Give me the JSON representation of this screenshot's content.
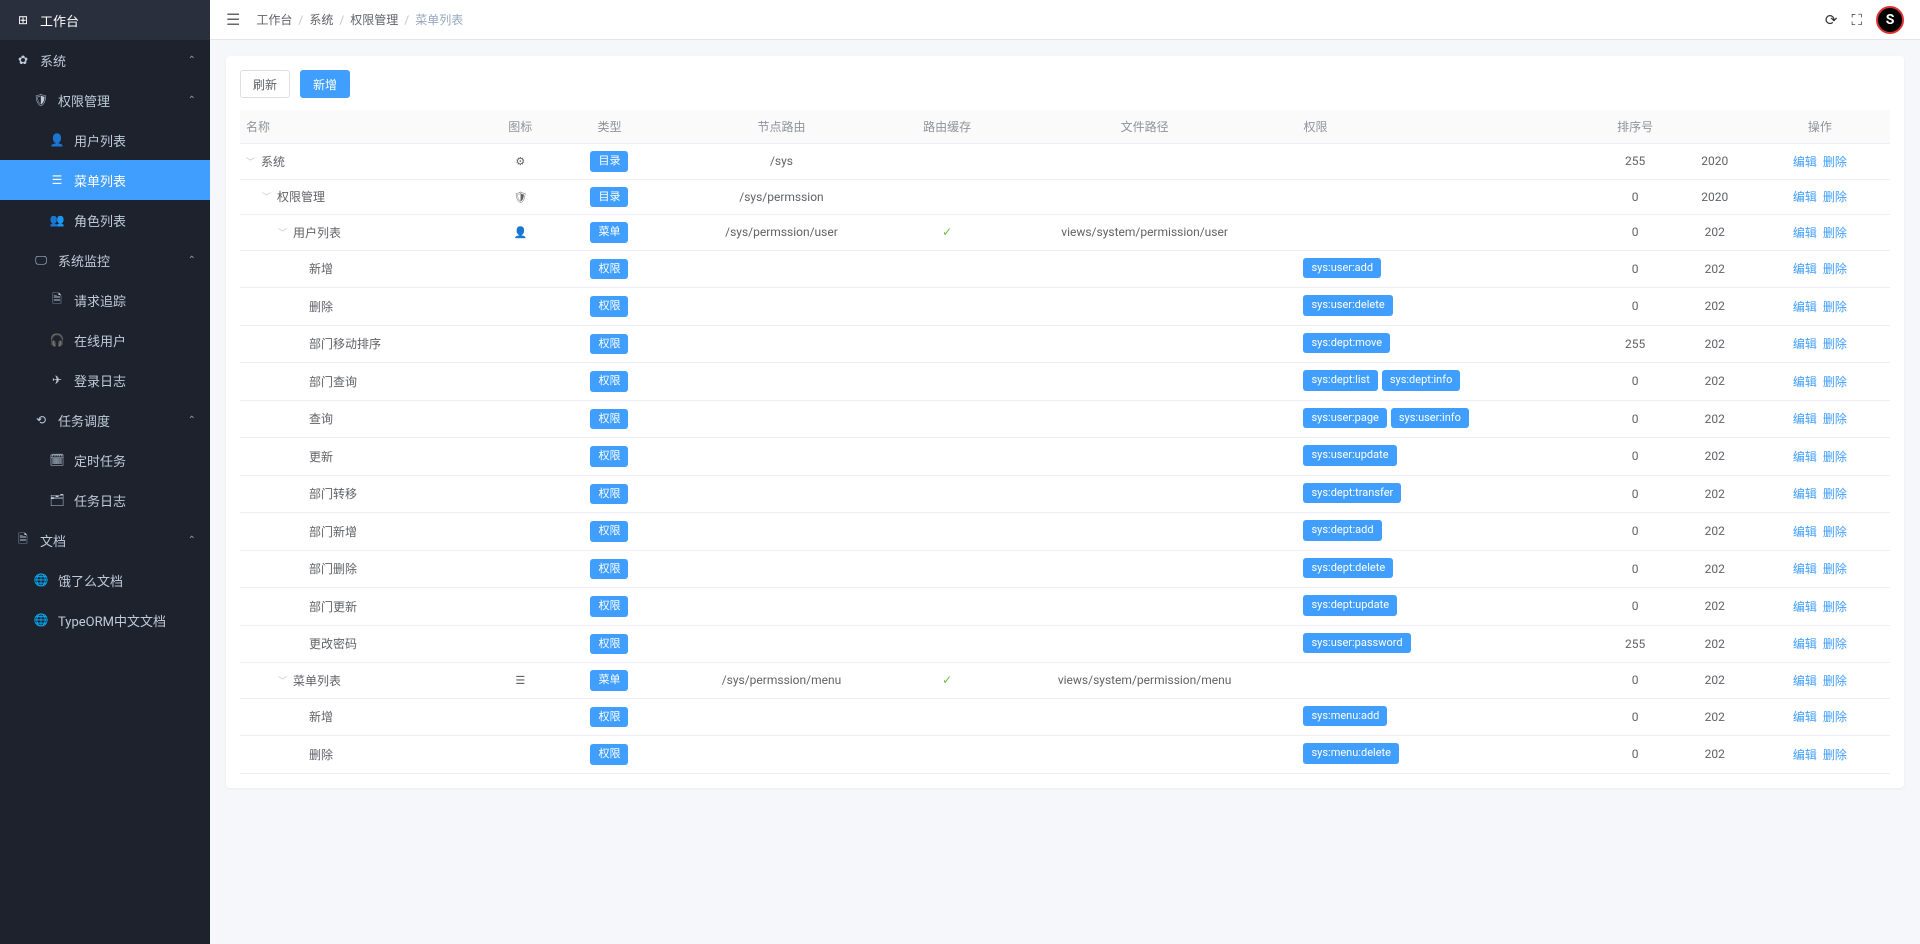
{
  "sidebar": {
    "items": [
      {
        "label": "工作台",
        "icon": "⊞",
        "level": 0
      },
      {
        "label": "系统",
        "icon": "✿",
        "level": 0,
        "arrow": "up"
      },
      {
        "label": "权限管理",
        "icon": "🛡",
        "level": 1,
        "arrow": "up"
      },
      {
        "label": "用户列表",
        "icon": "👤",
        "level": 2
      },
      {
        "label": "菜单列表",
        "icon": "☰",
        "level": 2,
        "active": true
      },
      {
        "label": "角色列表",
        "icon": "👥",
        "level": 2
      },
      {
        "label": "系统监控",
        "icon": "🖵",
        "level": 1,
        "arrow": "up"
      },
      {
        "label": "请求追踪",
        "icon": "🗎",
        "level": 2
      },
      {
        "label": "在线用户",
        "icon": "🎧",
        "level": 2
      },
      {
        "label": "登录日志",
        "icon": "✈",
        "level": 2
      },
      {
        "label": "任务调度",
        "icon": "⟲",
        "level": 1,
        "arrow": "up"
      },
      {
        "label": "定时任务",
        "icon": "🗓",
        "level": 2
      },
      {
        "label": "任务日志",
        "icon": "🗂",
        "level": 2
      },
      {
        "label": "文档",
        "icon": "🗎",
        "level": 0,
        "arrow": "up"
      },
      {
        "label": "饿了么文档",
        "icon": "🌐",
        "level": 1
      },
      {
        "label": "TypeORM中文文档",
        "icon": "🌐",
        "level": 1
      }
    ]
  },
  "breadcrumb": {
    "items": [
      "工作台",
      "系统",
      "权限管理",
      "菜单列表"
    ]
  },
  "toolbar": {
    "refresh": "刷新",
    "add": "新增"
  },
  "table": {
    "headers": {
      "name": "名称",
      "icon": "图标",
      "type": "类型",
      "route": "节点路由",
      "cache": "路由缓存",
      "file": "文件路径",
      "perm": "权限",
      "sort": "排序号",
      "time": "",
      "op": "操作"
    },
    "actions": {
      "edit": "编辑",
      "delete": "删除"
    },
    "typeLabels": {
      "dir": "目录",
      "menu": "菜单",
      "perm": "权限"
    },
    "rows": [
      {
        "indent": 0,
        "caret": true,
        "name": "系统",
        "icon": "⚙",
        "type": "dir",
        "route": "/sys",
        "cache": "",
        "file": "",
        "perms": [],
        "sort": "255",
        "time": "2020"
      },
      {
        "indent": 1,
        "caret": true,
        "name": "权限管理",
        "icon": "🛡",
        "type": "dir",
        "route": "/sys/permssion",
        "cache": "",
        "file": "",
        "perms": [],
        "sort": "0",
        "time": "2020"
      },
      {
        "indent": 2,
        "caret": true,
        "name": "用户列表",
        "icon": "👤",
        "type": "menu",
        "route": "/sys/permssion/user",
        "cache": "✓",
        "file": "views/system/permission/user",
        "perms": [],
        "sort": "0",
        "time": "202"
      },
      {
        "indent": 3,
        "caret": false,
        "name": "新增",
        "icon": "",
        "type": "perm",
        "route": "",
        "cache": "",
        "file": "",
        "perms": [
          "sys:user:add"
        ],
        "sort": "0",
        "time": "202"
      },
      {
        "indent": 3,
        "caret": false,
        "name": "删除",
        "icon": "",
        "type": "perm",
        "route": "",
        "cache": "",
        "file": "",
        "perms": [
          "sys:user:delete"
        ],
        "sort": "0",
        "time": "202"
      },
      {
        "indent": 3,
        "caret": false,
        "name": "部门移动排序",
        "icon": "",
        "type": "perm",
        "route": "",
        "cache": "",
        "file": "",
        "perms": [
          "sys:dept:move"
        ],
        "sort": "255",
        "time": "202"
      },
      {
        "indent": 3,
        "caret": false,
        "name": "部门查询",
        "icon": "",
        "type": "perm",
        "route": "",
        "cache": "",
        "file": "",
        "perms": [
          "sys:dept:list",
          "sys:dept:info"
        ],
        "sort": "0",
        "time": "202"
      },
      {
        "indent": 3,
        "caret": false,
        "name": "查询",
        "icon": "",
        "type": "perm",
        "route": "",
        "cache": "",
        "file": "",
        "perms": [
          "sys:user:page",
          "sys:user:info"
        ],
        "sort": "0",
        "time": "202"
      },
      {
        "indent": 3,
        "caret": false,
        "name": "更新",
        "icon": "",
        "type": "perm",
        "route": "",
        "cache": "",
        "file": "",
        "perms": [
          "sys:user:update"
        ],
        "sort": "0",
        "time": "202"
      },
      {
        "indent": 3,
        "caret": false,
        "name": "部门转移",
        "icon": "",
        "type": "perm",
        "route": "",
        "cache": "",
        "file": "",
        "perms": [
          "sys:dept:transfer"
        ],
        "sort": "0",
        "time": "202"
      },
      {
        "indent": 3,
        "caret": false,
        "name": "部门新增",
        "icon": "",
        "type": "perm",
        "route": "",
        "cache": "",
        "file": "",
        "perms": [
          "sys:dept:add"
        ],
        "sort": "0",
        "time": "202"
      },
      {
        "indent": 3,
        "caret": false,
        "name": "部门删除",
        "icon": "",
        "type": "perm",
        "route": "",
        "cache": "",
        "file": "",
        "perms": [
          "sys:dept:delete"
        ],
        "sort": "0",
        "time": "202"
      },
      {
        "indent": 3,
        "caret": false,
        "name": "部门更新",
        "icon": "",
        "type": "perm",
        "route": "",
        "cache": "",
        "file": "",
        "perms": [
          "sys:dept:update"
        ],
        "sort": "0",
        "time": "202"
      },
      {
        "indent": 3,
        "caret": false,
        "name": "更改密码",
        "icon": "",
        "type": "perm",
        "route": "",
        "cache": "",
        "file": "",
        "perms": [
          "sys:user:password"
        ],
        "sort": "255",
        "time": "202"
      },
      {
        "indent": 2,
        "caret": true,
        "name": "菜单列表",
        "icon": "☰",
        "type": "menu",
        "route": "/sys/permssion/menu",
        "cache": "✓",
        "file": "views/system/permission/menu",
        "perms": [],
        "sort": "0",
        "time": "202"
      },
      {
        "indent": 3,
        "caret": false,
        "name": "新增",
        "icon": "",
        "type": "perm",
        "route": "",
        "cache": "",
        "file": "",
        "perms": [
          "sys:menu:add"
        ],
        "sort": "0",
        "time": "202"
      },
      {
        "indent": 3,
        "caret": false,
        "name": "删除",
        "icon": "",
        "type": "perm",
        "route": "",
        "cache": "",
        "file": "",
        "perms": [
          "sys:menu:delete"
        ],
        "sort": "0",
        "time": "202"
      }
    ]
  },
  "avatar": {
    "letter": "S"
  }
}
